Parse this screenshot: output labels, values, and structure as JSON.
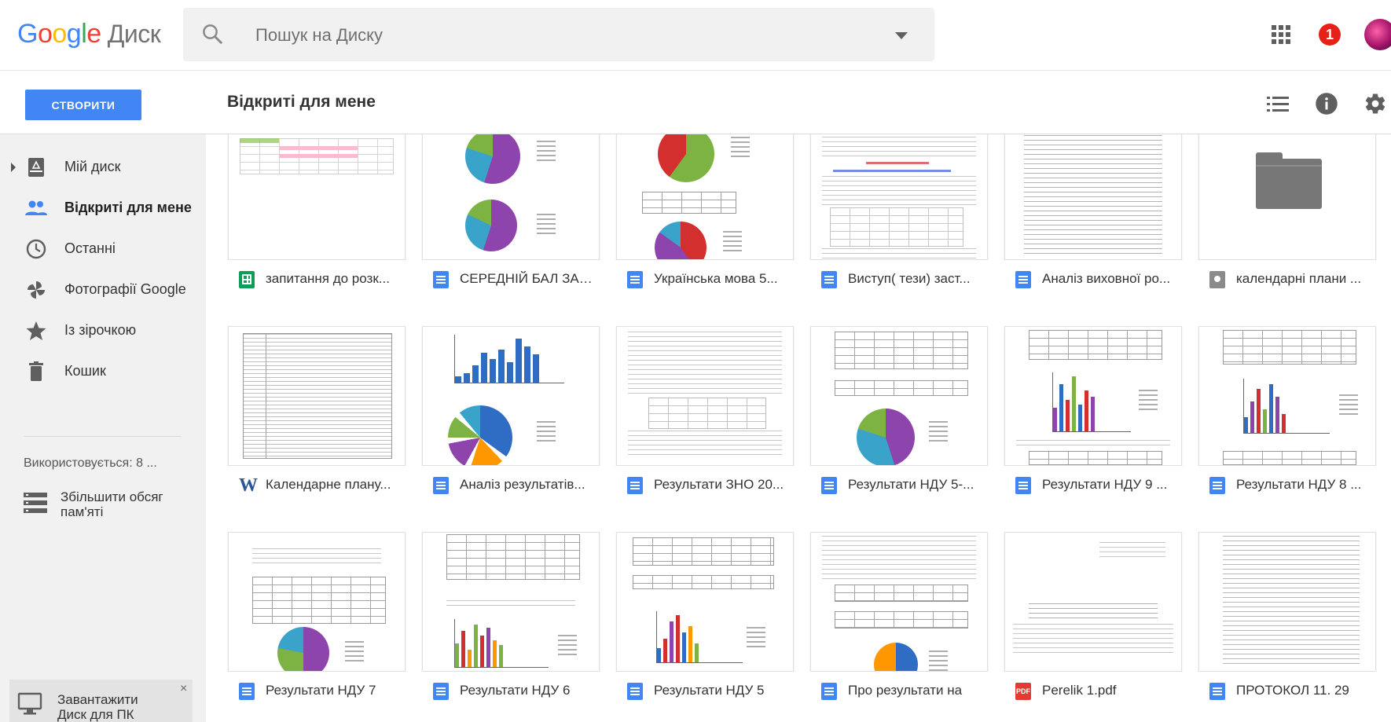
{
  "header": {
    "logo": {
      "letters": [
        "G",
        "o",
        "o",
        "g",
        "l",
        "e"
      ],
      "product": "Диск"
    },
    "search": {
      "placeholder": "Пошук на Диску",
      "value": ""
    },
    "notification_count": "1",
    "icons": [
      "search-icon",
      "caret-down-icon",
      "apps-grid-icon",
      "notification-icon",
      "avatar"
    ]
  },
  "toolbar": {
    "create_label": "СТВОРИТИ",
    "page_title": "Відкриті для мене",
    "icons": [
      "list-view-icon",
      "info-icon",
      "settings-gear-icon"
    ]
  },
  "sidebar": {
    "items": [
      {
        "label": "Мій диск",
        "icon": "drive-icon",
        "active": false
      },
      {
        "label": "Відкриті для мене",
        "icon": "shared-people-icon",
        "active": true
      },
      {
        "label": "Останні",
        "icon": "clock-icon",
        "active": false
      },
      {
        "label": "Фотографії Google",
        "icon": "photos-pinwheel-icon",
        "active": false
      },
      {
        "label": "Із зірочкою",
        "icon": "star-icon",
        "active": false
      },
      {
        "label": "Кошик",
        "icon": "trash-icon",
        "active": false
      }
    ],
    "storage_text": "Використовується: 8 ...",
    "upgrade_label": "Збільшити обсяг пам'яті",
    "download_label": "Завантажити Диск для ПК",
    "download_close": "×"
  },
  "files": [
    {
      "name": "запитання до розк...",
      "type": "sheet",
      "icon": "sheets-file-icon"
    },
    {
      "name": "СЕРЕДНІЙ БАЛ ЗА ...",
      "type": "doc",
      "icon": "docs-file-icon"
    },
    {
      "name": "Українська мова 5...",
      "type": "doc",
      "icon": "docs-file-icon"
    },
    {
      "name": "Виступ( тези) заст...",
      "type": "doc",
      "icon": "docs-file-icon"
    },
    {
      "name": "Аналіз виховної ро...",
      "type": "doc",
      "icon": "docs-file-icon"
    },
    {
      "name": "календарні плани ...",
      "type": "folder",
      "icon": "shared-folder-icon"
    },
    {
      "name": "Календарне плану...",
      "type": "word",
      "icon": "word-file-icon"
    },
    {
      "name": "Аналіз результатів...",
      "type": "doc",
      "icon": "docs-file-icon"
    },
    {
      "name": "Результати ЗНО 20...",
      "type": "doc",
      "icon": "docs-file-icon"
    },
    {
      "name": "Результати НДУ 5-...",
      "type": "doc",
      "icon": "docs-file-icon"
    },
    {
      "name": "Результати НДУ 9 ...",
      "type": "doc",
      "icon": "docs-file-icon"
    },
    {
      "name": "Результати НДУ 8 ...",
      "type": "doc",
      "icon": "docs-file-icon"
    },
    {
      "name": "Результати НДУ 7",
      "type": "doc",
      "icon": "docs-file-icon"
    },
    {
      "name": "Результати НДУ 6",
      "type": "doc",
      "icon": "docs-file-icon"
    },
    {
      "name": "Результати НДУ 5",
      "type": "doc",
      "icon": "docs-file-icon"
    },
    {
      "name": "Про результати на",
      "type": "doc",
      "icon": "docs-file-icon"
    },
    {
      "name": "Perelik 1.pdf",
      "type": "pdf",
      "icon": "pdf-file-icon"
    },
    {
      "name": "ПРОТОКОЛ 11. 29",
      "type": "doc",
      "icon": "docs-file-icon"
    }
  ],
  "colors": {
    "accent": "#4285f4",
    "docs": "#4285f4",
    "sheets": "#0f9d58",
    "word": "#2a5699",
    "pdf": "#e53935",
    "notification": "#e62117",
    "sidebar_bg": "#f1f1f1"
  }
}
